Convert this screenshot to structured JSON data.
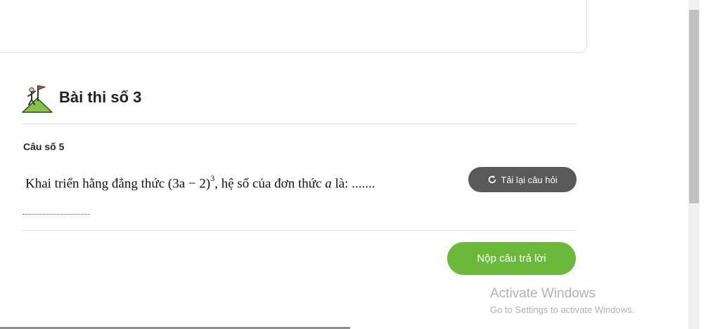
{
  "exam": {
    "title": "Bài thi số 3",
    "icon": "mountain-flag-icon"
  },
  "question": {
    "number_label": "Câu số 5",
    "text_before": "Khai triển hằng đẳng thức ",
    "expression": "(3a − 2)",
    "exponent": "3",
    "text_middle": ", hệ số của đơn thức ",
    "variable": "a",
    "text_after": " là: ......."
  },
  "buttons": {
    "reload_label": "Tải lại câu hỏi",
    "submit_label": "Nộp câu trả lời"
  },
  "watermark": {
    "title": "Activate Windows",
    "subtitle": "Go to Settings to activate Windows."
  },
  "colors": {
    "submit": "#6bb83a",
    "reload": "#595959"
  }
}
